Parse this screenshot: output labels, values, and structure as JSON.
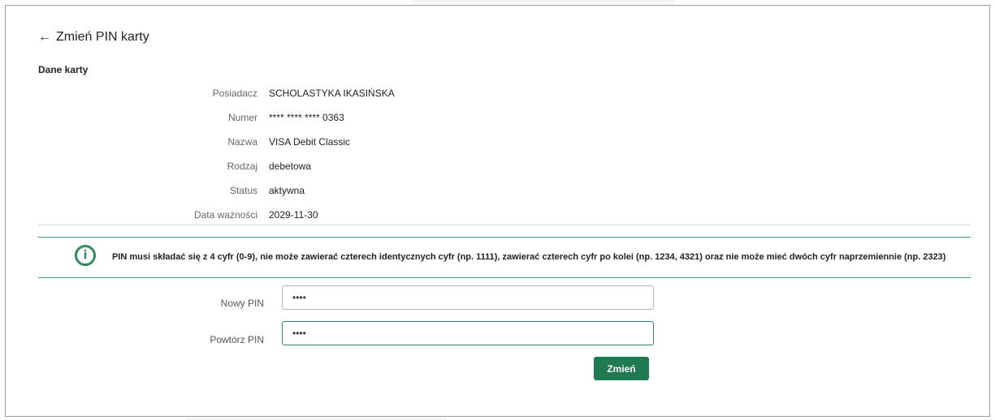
{
  "header": {
    "back_arrow": "←",
    "title": "Zmień PIN karty"
  },
  "card_section": {
    "title": "Dane karty",
    "fields": [
      {
        "label": "Posiadacz",
        "value": "SCHOLASTYKA IKASIŃSKA"
      },
      {
        "label": "Numer",
        "value": "**** **** **** 0363"
      },
      {
        "label": "Nazwa",
        "value": "VISA Debit Classic"
      },
      {
        "label": "Rodzaj",
        "value": "debetowa"
      },
      {
        "label": "Status",
        "value": "aktywna"
      },
      {
        "label": "Data ważności",
        "value": "2029-11-30"
      }
    ]
  },
  "info": {
    "icon": "info-icon",
    "icon_glyph": "i",
    "text": "PIN musi składać się z 4 cyfr (0-9), nie może zawierać czterech identycznych cyfr (np. 1111), zawierać czterech cyfr po kolei (np. 1234, 4321) oraz nie może mieć dwóch cyfr naprzemiennie (np. 2323)",
    "accent_color": "#2f8a5e"
  },
  "form": {
    "new_pin_label": "Nowy PIN",
    "new_pin_value": "••••",
    "repeat_pin_label": "Powtórz PIN",
    "repeat_pin_value": "••••",
    "submit_label": "Zmień"
  },
  "colors": {
    "primary": "#1f7a52",
    "divider": "#2f9c72"
  }
}
